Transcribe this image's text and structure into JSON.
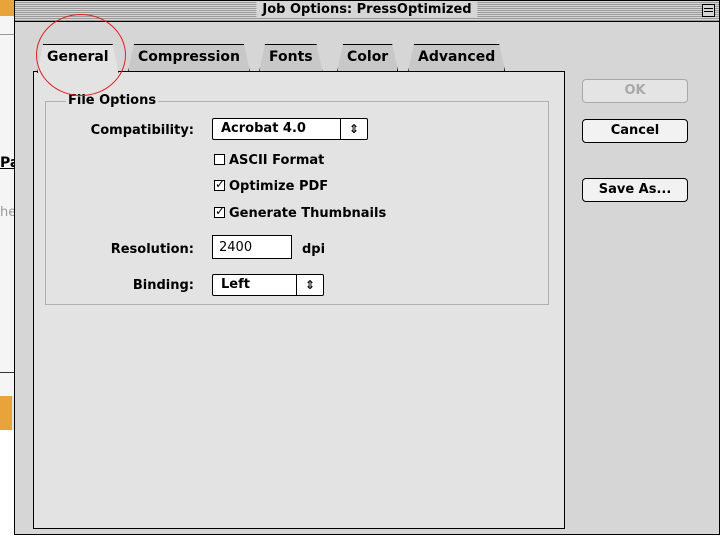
{
  "background_window": {
    "fragment_1": "Pa",
    "fragment_2": "he"
  },
  "window": {
    "title": "Job Options: PressOptimized"
  },
  "tabs": [
    {
      "label": "General",
      "active": true
    },
    {
      "label": "Compression",
      "active": false
    },
    {
      "label": "Fonts",
      "active": false
    },
    {
      "label": "Color",
      "active": false
    },
    {
      "label": "Advanced",
      "active": false
    }
  ],
  "file_options": {
    "group_label": "File Options",
    "compatibility_label": "Compatibility:",
    "compatibility_value": "Acrobat 4.0",
    "checkboxes": [
      {
        "label": "ASCII Format",
        "checked": false
      },
      {
        "label": "Optimize PDF",
        "checked": true
      },
      {
        "label": "Generate Thumbnails",
        "checked": true
      }
    ],
    "resolution_label": "Resolution:",
    "resolution_value": "2400",
    "resolution_unit": "dpi",
    "binding_label": "Binding:",
    "binding_value": "Left"
  },
  "buttons": {
    "ok": "OK",
    "cancel": "Cancel",
    "save_as": "Save As..."
  },
  "icons": {
    "zoom": "zoom-box-icon",
    "popup_arrows": "up-down-arrows-icon",
    "checkmark": "checkmark-icon"
  },
  "colors": {
    "highlight": "#e02020",
    "accent_background": "#e9a33b"
  }
}
